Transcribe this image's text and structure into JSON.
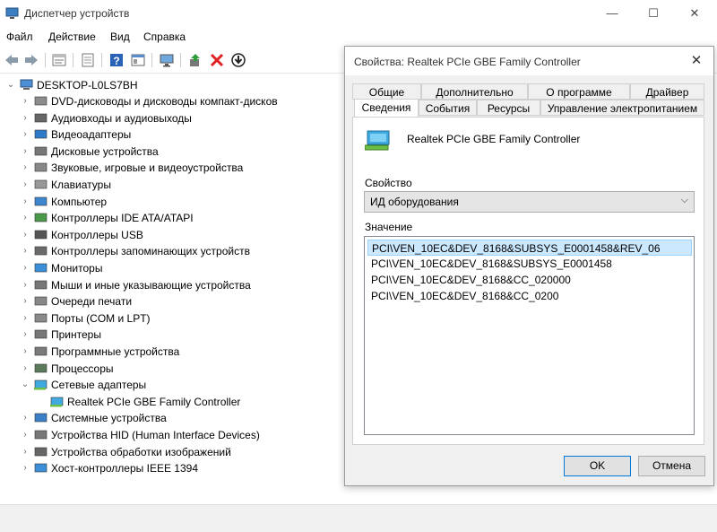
{
  "window": {
    "title": "Диспетчер устройств",
    "minimize": "—",
    "maximize": "☐",
    "close": "✕"
  },
  "menu": [
    "Файл",
    "Действие",
    "Вид",
    "Справка"
  ],
  "toolbar": {
    "icons": [
      "back-icon",
      "forward-icon",
      "properties-icon",
      "refresh-icon",
      "help-icon",
      "view-icon",
      "monitor-icon",
      "update-driver-icon",
      "uninstall-icon",
      "download-icon"
    ]
  },
  "tree": {
    "root": "DESKTOP-L0LS7BH",
    "items": [
      {
        "label": "DVD-дисководы и дисководы компакт-дисков",
        "icon": "dvd-icon"
      },
      {
        "label": "Аудиовходы и аудиовыходы",
        "icon": "speaker-icon"
      },
      {
        "label": "Видеоадаптеры",
        "icon": "display-adapter-icon"
      },
      {
        "label": "Дисковые устройства",
        "icon": "disk-icon"
      },
      {
        "label": "Звуковые, игровые и видеоустройства",
        "icon": "sound-icon"
      },
      {
        "label": "Клавиатуры",
        "icon": "keyboard-icon"
      },
      {
        "label": "Компьютер",
        "icon": "computer-icon"
      },
      {
        "label": "Контроллеры IDE ATA/ATAPI",
        "icon": "ide-icon"
      },
      {
        "label": "Контроллеры USB",
        "icon": "usb-icon"
      },
      {
        "label": "Контроллеры запоминающих устройств",
        "icon": "storage-icon"
      },
      {
        "label": "Мониторы",
        "icon": "monitor-icon"
      },
      {
        "label": "Мыши и иные указывающие устройства",
        "icon": "mouse-icon"
      },
      {
        "label": "Очереди печати",
        "icon": "print-queue-icon"
      },
      {
        "label": "Порты (COM и LPT)",
        "icon": "port-icon"
      },
      {
        "label": "Принтеры",
        "icon": "printer-icon"
      },
      {
        "label": "Программные устройства",
        "icon": "software-device-icon"
      },
      {
        "label": "Процессоры",
        "icon": "processor-icon"
      },
      {
        "label": "Сетевые адаптеры",
        "icon": "network-icon",
        "expanded": true
      },
      {
        "label": "Realtek PCIe GBE Family Controller",
        "icon": "network-card-icon",
        "child": true
      },
      {
        "label": "Системные устройства",
        "icon": "system-icon"
      },
      {
        "label": "Устройства HID (Human Interface Devices)",
        "icon": "hid-icon"
      },
      {
        "label": "Устройства обработки изображений",
        "icon": "camera-icon"
      },
      {
        "label": "Хост-контроллеры IEEE 1394",
        "icon": "ieee1394-icon"
      }
    ]
  },
  "dialog": {
    "title": "Свойства: Realtek PCIe GBE Family Controller",
    "close": "✕",
    "tabs_row1": [
      "Общие",
      "Дополнительно",
      "О программе",
      "Драйвер"
    ],
    "tabs_row2": [
      "Сведения",
      "События",
      "Ресурсы",
      "Управление электропитанием"
    ],
    "active_tab": "Сведения",
    "device_name": "Realtek PCIe GBE Family Controller",
    "property_label": "Свойство",
    "property_value": "ИД оборудования",
    "value_label": "Значение",
    "values": [
      "PCI\\VEN_10EC&DEV_8168&SUBSYS_E0001458&REV_06",
      "PCI\\VEN_10EC&DEV_8168&SUBSYS_E0001458",
      "PCI\\VEN_10EC&DEV_8168&CC_020000",
      "PCI\\VEN_10EC&DEV_8168&CC_0200"
    ],
    "ok": "OK",
    "cancel": "Отмена"
  },
  "colors": {
    "selection": "#cce8ff",
    "accent": "#0078d7",
    "dialog_bg": "#f0f0f0"
  }
}
